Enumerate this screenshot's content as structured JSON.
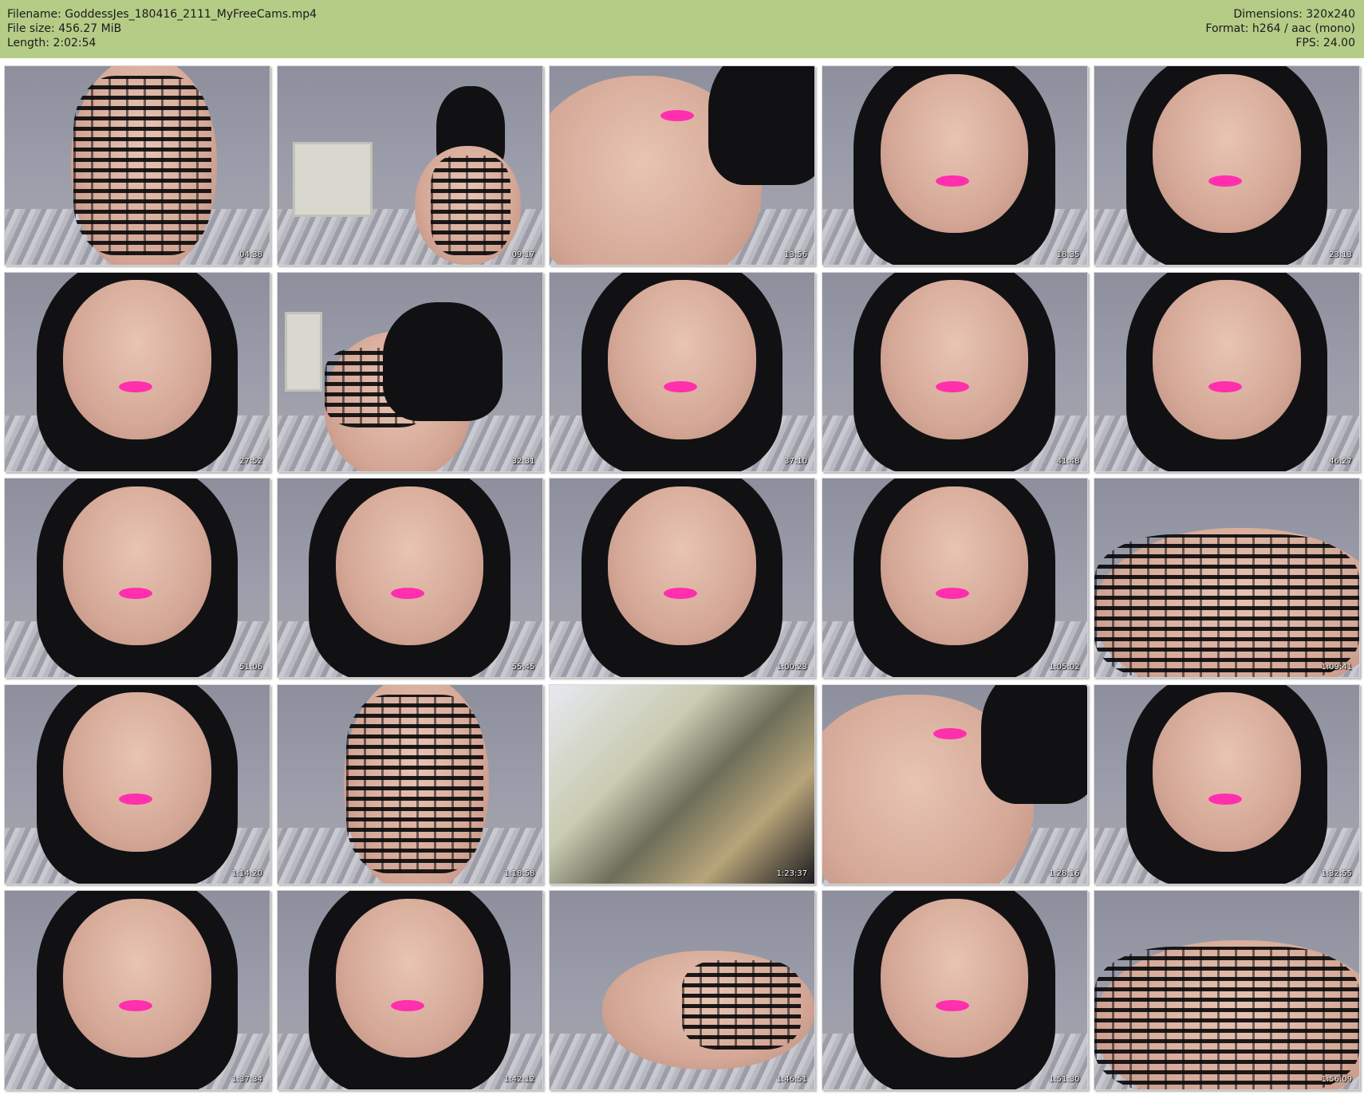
{
  "header": {
    "filename_line": "Filename: GoddessJes_180416_2111_MyFreeCams.mp4",
    "filesize_line": "File size: 456.27 MiB",
    "length_line": "Length: 2:02:54",
    "dimensions_line": "Dimensions: 320x240",
    "format_line": "Format: h264 / aac (mono)",
    "fps_line": "FPS: 24.00",
    "background_color": "#b5cc87"
  },
  "thumbnails": [
    {
      "time": "04:38"
    },
    {
      "time": "09:17"
    },
    {
      "time": "13:56"
    },
    {
      "time": "18:35"
    },
    {
      "time": "23:13"
    },
    {
      "time": "27:52"
    },
    {
      "time": "32:31"
    },
    {
      "time": "37:10"
    },
    {
      "time": "41:48"
    },
    {
      "time": "46:27"
    },
    {
      "time": "51:06"
    },
    {
      "time": "55:45"
    },
    {
      "time": "1:00:23"
    },
    {
      "time": "1:05:02"
    },
    {
      "time": "1:09:41"
    },
    {
      "time": "1:14:20"
    },
    {
      "time": "1:18:58"
    },
    {
      "time": "1:23:37"
    },
    {
      "time": "1:28:16"
    },
    {
      "time": "1:32:55"
    },
    {
      "time": "1:37:34"
    },
    {
      "time": "1:42:12"
    },
    {
      "time": "1:46:51"
    },
    {
      "time": "1:51:30"
    },
    {
      "time": "1:56:09"
    }
  ]
}
